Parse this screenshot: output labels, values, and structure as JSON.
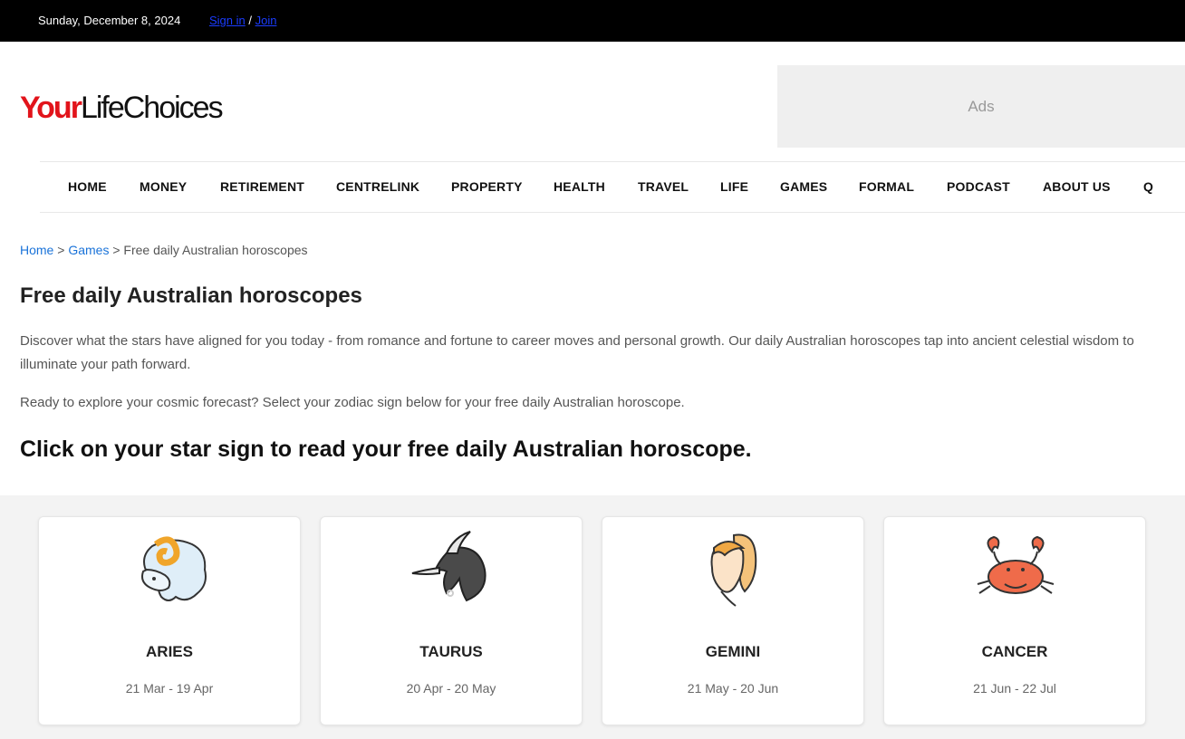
{
  "topbar": {
    "date": "Sunday, December 8, 2024",
    "sign_in": "Sign in",
    "separator": " / ",
    "join": "Join"
  },
  "header": {
    "logo_your": "Your",
    "logo_rest": "LifeChoices",
    "ads_label": "Ads"
  },
  "nav": {
    "items": [
      "HOME",
      "MONEY",
      "RETIREMENT",
      "CENTRELINK",
      "PROPERTY",
      "HEALTH",
      "TRAVEL",
      "LIFE",
      "GAMES",
      "FORMAL",
      "PODCAST",
      "ABOUT US"
    ],
    "search_glyph": "Q"
  },
  "breadcrumb": {
    "home": "Home",
    "sep1": " > ",
    "games": "Games",
    "sep2": " > ",
    "current": "Free daily Australian horoscopes"
  },
  "page": {
    "title": "Free daily Australian horoscopes",
    "intro": "Discover what the stars have aligned for you today - from romance and fortune to career moves and personal growth. Our daily Australian horoscopes tap into ancient celestial wisdom to illuminate your path forward.",
    "ready": "Ready to explore your cosmic forecast? Select your zodiac sign below for your free daily Australian horoscope.",
    "cta": "Click on your star sign to read your free daily Australian horoscope."
  },
  "signs": [
    {
      "name": "ARIES",
      "dates": "21 Mar - 19 Apr",
      "icon": "ram-icon"
    },
    {
      "name": "TAURUS",
      "dates": "20 Apr - 20 May",
      "icon": "bull-icon"
    },
    {
      "name": "GEMINI",
      "dates": "21 May - 20 Jun",
      "icon": "twins-icon"
    },
    {
      "name": "CANCER",
      "dates": "21 Jun - 22 Jul",
      "icon": "crab-icon"
    }
  ],
  "colors": {
    "brand_red": "#e2141b",
    "link_blue": "#1a73d9",
    "topbar_bg": "#000000"
  }
}
